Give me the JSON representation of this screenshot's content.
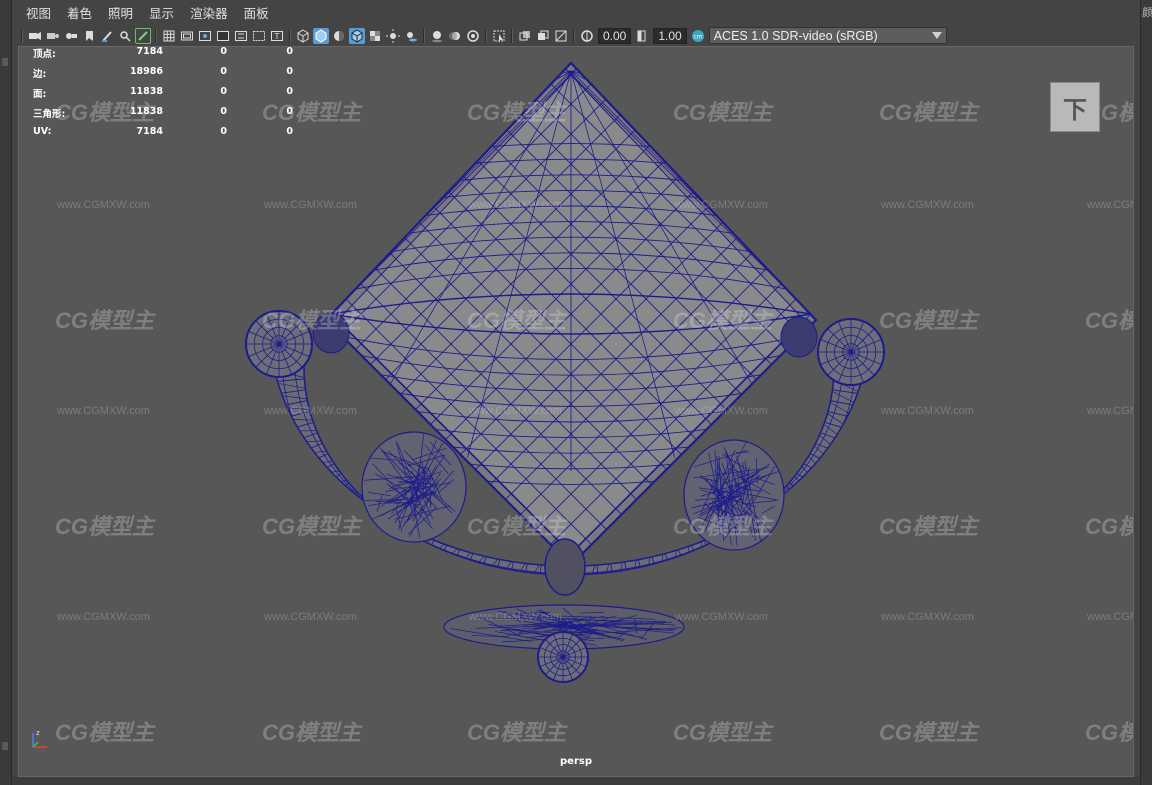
{
  "menu": {
    "items": [
      "视图",
      "着色",
      "照明",
      "显示",
      "渲染器",
      "面板"
    ]
  },
  "toolbar": {
    "exposure": "0.00",
    "gamma": "1.00",
    "color_management": "ACES 1.0 SDR-video (sRGB)",
    "icons": [
      "camera-select-icon",
      "camera-attr-icon",
      "bookmark-icon",
      "image-plane-icon",
      "grease-pencil-icon",
      "2d-pan-zoom-icon",
      "grid-icon",
      "film-gate-icon",
      "resolution-gate-icon",
      "gate-mask-icon",
      "field-chart-icon",
      "safe-action-icon",
      "safe-title-icon",
      "wireframe-icon",
      "smooth-shade-icon",
      "default-material-icon",
      "wireframe-on-shaded-icon",
      "textured-icon",
      "lights-icon",
      "shadows-icon",
      "screen-space-ao-icon",
      "motion-blur-icon",
      "anti-alias-icon",
      "depth-of-field-icon",
      "isolate-select-icon",
      "xray-icon",
      "xray-active-components-icon",
      "xray-joints-icon",
      "backface-culling-icon",
      "exposure-icon",
      "gamma-icon",
      "color-management-icon"
    ]
  },
  "hud": {
    "rows": [
      {
        "label": "顶点:",
        "v1": "7184",
        "v2": "0",
        "v3": "0"
      },
      {
        "label": "边:",
        "v1": "18986",
        "v2": "0",
        "v3": "0"
      },
      {
        "label": "面:",
        "v1": "11838",
        "v2": "0",
        "v3": "0"
      },
      {
        "label": "三角形:",
        "v1": "11838",
        "v2": "0",
        "v3": "0"
      },
      {
        "label": "UV:",
        "v1": "7184",
        "v2": "0",
        "v3": "0"
      }
    ]
  },
  "view_cube": {
    "label": "下"
  },
  "camera": {
    "name": "persp"
  },
  "watermark": {
    "logo": "CG模型主",
    "url": "www.CGMXW.com"
  },
  "right_panel": {
    "glyph": "颜"
  },
  "colors": {
    "wireframe": "#1c1c8c",
    "viewport_bg": "#575757",
    "active_icon": "#5b9bd4"
  }
}
